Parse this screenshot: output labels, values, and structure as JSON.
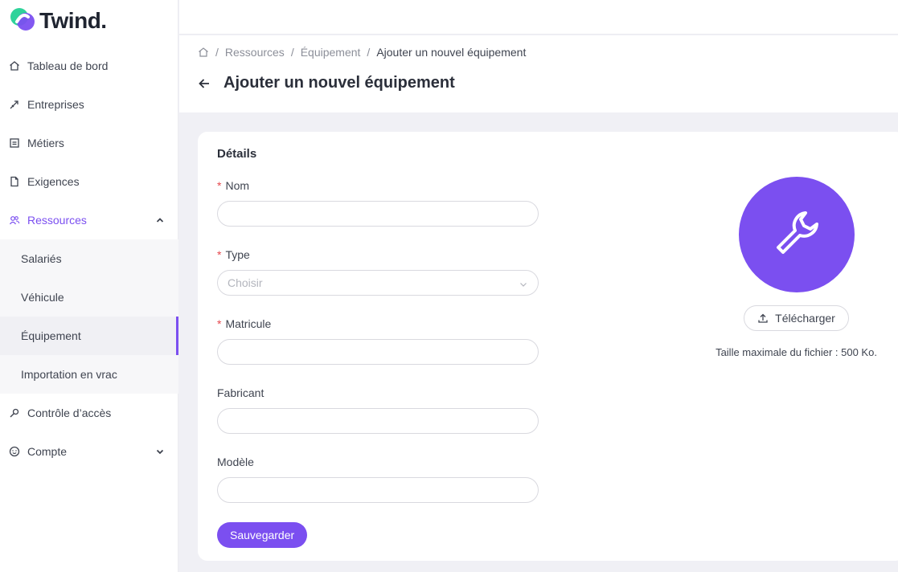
{
  "brand": {
    "name": "Twind."
  },
  "sidebar": {
    "items": [
      {
        "label": "Tableau de bord",
        "icon": "home-icon"
      },
      {
        "label": "Entreprises",
        "icon": "rocket-icon"
      },
      {
        "label": "Métiers",
        "icon": "briefcase-icon"
      },
      {
        "label": "Exigences",
        "icon": "document-icon"
      },
      {
        "label": "Ressources",
        "icon": "users-icon",
        "expanded": true
      },
      {
        "label": "Contrôle d’accès",
        "icon": "key-icon"
      },
      {
        "label": "Compte",
        "icon": "smile-icon",
        "expanded": false
      }
    ],
    "subitems": [
      {
        "label": "Salariés"
      },
      {
        "label": "Véhicule"
      },
      {
        "label": "Équipement",
        "selected": true
      },
      {
        "label": "Importation en vrac"
      }
    ]
  },
  "breadcrumb": {
    "items": [
      "Ressources",
      "Équipement"
    ],
    "current": "Ajouter un nouvel équipement"
  },
  "page": {
    "title": "Ajouter un nouvel équipement"
  },
  "form": {
    "section_title": "Détails",
    "required_marker": "*",
    "fields": {
      "nom": {
        "label": "Nom",
        "required": true,
        "value": ""
      },
      "type": {
        "label": "Type",
        "required": true,
        "placeholder": "Choisir"
      },
      "matricule": {
        "label": "Matricule",
        "required": true,
        "value": ""
      },
      "fabricant": {
        "label": "Fabricant",
        "required": false,
        "value": ""
      },
      "modele": {
        "label": "Modèle",
        "required": false,
        "value": ""
      }
    },
    "save_label": "Sauvegarder"
  },
  "upload": {
    "button_label": "Télécharger",
    "note": "Taille maximale du fichier : 500 Ko.",
    "icon": "wrench-icon"
  },
  "colors": {
    "accent": "#7b4ff0",
    "required": "#e5484d",
    "logo_green": "#2fd39a",
    "logo_purple": "#7b4ff0"
  }
}
